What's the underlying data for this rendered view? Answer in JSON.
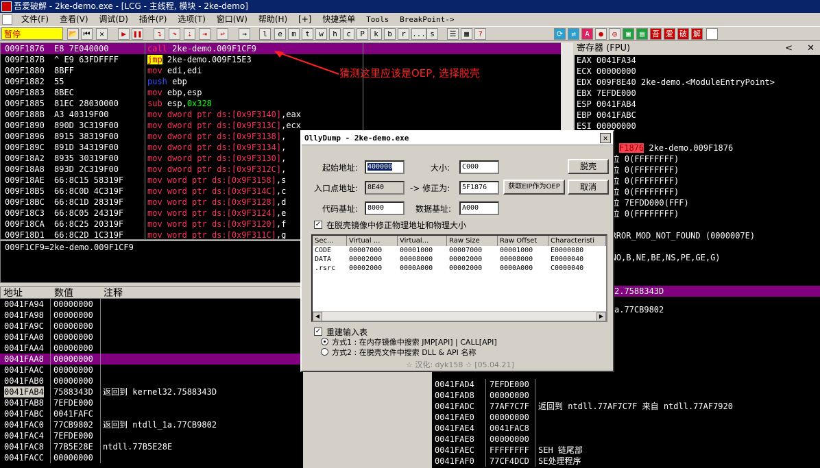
{
  "window": {
    "title": "吾爱破解 - 2ke-demo.exe - [LCG - 主线程, 模块 - 2ke-demo]"
  },
  "menu": [
    "文件(F)",
    "查看(V)",
    "调试(D)",
    "插件(P)",
    "选项(T)",
    "窗口(W)",
    "帮助(H)",
    "[+]",
    "快捷菜单",
    "Tools",
    "BreakPoint->"
  ],
  "toolbar": {
    "status": "暂停",
    "letters": [
      "l",
      "e",
      "m",
      "t",
      "w",
      "h",
      "c",
      "P",
      "k",
      "b",
      "r",
      "...",
      "s"
    ],
    "right_letters": [
      "A",
      "吾",
      "爱",
      "破",
      "解"
    ]
  },
  "disasm": {
    "rows": [
      {
        "addr": "009F1876",
        "hex": "E8 7E040000",
        "mn": "call",
        "op": "2ke-demo.009F1CF9",
        "sel": true
      },
      {
        "addr": "009F187B",
        "hex": "^ E9 63FDFFFF",
        "mn": "jmp",
        "op": "2ke-demo.009F15E3"
      },
      {
        "addr": "009F1880",
        "hex": "8BFF",
        "mn": "mov",
        "op": "edi,edi"
      },
      {
        "addr": "009F1882",
        "hex": "55",
        "mn": "push",
        "op": "ebp"
      },
      {
        "addr": "009F1883",
        "hex": "8BEC",
        "mn": "mov",
        "op": "ebp,esp"
      },
      {
        "addr": "009F1885",
        "hex": "81EC 28030000",
        "mn": "sub",
        "op": "esp,0x328"
      },
      {
        "addr": "009F188B",
        "hex": "A3 40319F00",
        "mn": "mov",
        "op": "dword ptr ds:[0x9F3140],eax"
      },
      {
        "addr": "009F1890",
        "hex": "890D 3C319F00",
        "mn": "mov",
        "op": "dword ptr ds:[0x9F313C],ecx"
      },
      {
        "addr": "009F1896",
        "hex": "8915 38319F00",
        "mn": "mov",
        "op": "dword ptr ds:[0x9F3138],"
      },
      {
        "addr": "009F189C",
        "hex": "891D 34319F00",
        "mn": "mov",
        "op": "dword ptr ds:[0x9F3134],"
      },
      {
        "addr": "009F18A2",
        "hex": "8935 30319F00",
        "mn": "mov",
        "op": "dword ptr ds:[0x9F3130],"
      },
      {
        "addr": "009F18A8",
        "hex": "893D 2C319F00",
        "mn": "mov",
        "op": "dword ptr ds:[0x9F312C],"
      },
      {
        "addr": "009F18AE",
        "hex": "66:8C15 58319F",
        "mn": "mov",
        "op": "word ptr ds:[0x9F3158],s"
      },
      {
        "addr": "009F18B5",
        "hex": "66:8C0D 4C319F",
        "mn": "mov",
        "op": "word ptr ds:[0x9F314C],c"
      },
      {
        "addr": "009F18BC",
        "hex": "66:8C1D 28319F",
        "mn": "mov",
        "op": "word ptr ds:[0x9F3128],d"
      },
      {
        "addr": "009F18C3",
        "hex": "66:8C05 24319F",
        "mn": "mov",
        "op": "word ptr ds:[0x9F3124],e"
      },
      {
        "addr": "009F18CA",
        "hex": "66:8C25 20319F",
        "mn": "mov",
        "op": "word ptr ds:[0x9F3120],f"
      },
      {
        "addr": "009F18D1",
        "hex": "66:8C2D 1C319F",
        "mn": "mov",
        "op": "word ptr ds:[0x9F311C],g"
      }
    ],
    "info": "009F1CF9=2ke-demo.009F1CF9"
  },
  "annotation": "猜测这里应该是OEP, 选择脱壳",
  "registers": {
    "header": "寄存器 (FPU)",
    "rows": [
      {
        "t": "EAX 0041FA34"
      },
      {
        "t": "ECX 00000000"
      },
      {
        "t": "EDX 009F8E40 2ke-demo.<ModuleEntryPoint>"
      },
      {
        "t": "EBX 7EFDE000"
      },
      {
        "t": "ESP 0041FAB4"
      },
      {
        "t": "EBP 0041FABC"
      },
      {
        "t": "ESI 00000000"
      },
      {
        "t": ""
      },
      {
        "eip": "F1876",
        "t": " 2ke-demo.009F1876"
      },
      {
        "t": "    002B 32位 0(FFFFFFFF)"
      },
      {
        "t": "    0023 32位 0(FFFFFFFF)"
      },
      {
        "t": "    002B 32位 0(FFFFFFFF)"
      },
      {
        "t": "    002B 32位 0(FFFFFFFF)"
      },
      {
        "t": "    0053 32位 7EFDD000(FFF)"
      },
      {
        "t": "    002B 32位 0(FFFFFFFF)"
      },
      {
        "t": ""
      },
      {
        "t": "    stErr ERROR_MOD_NOT_FOUND (0000007E)"
      },
      {
        "t": ""
      },
      {
        "t": "    00207 (NO,B,NE,BE,NS,PE,GE,G)"
      },
      {
        "t": ""
      },
      {
        "t": "    ty 0.0"
      }
    ]
  },
  "dump": {
    "headers": [
      "地址",
      "数值",
      "注释"
    ],
    "rows": [
      {
        "a": "0041FA94",
        "v": "00000000",
        "c": ""
      },
      {
        "a": "0041FA98",
        "v": "00000000",
        "c": ""
      },
      {
        "a": "0041FA9C",
        "v": "00000000",
        "c": ""
      },
      {
        "a": "0041FAA0",
        "v": "00000000",
        "c": ""
      },
      {
        "a": "0041FAA4",
        "v": "00000000",
        "c": ""
      },
      {
        "a": "0041FAA8",
        "v": "00000000",
        "c": "",
        "hl": true
      },
      {
        "a": "0041FAAC",
        "v": "00000000",
        "c": ""
      },
      {
        "a": "0041FAB0",
        "v": "00000000",
        "c": ""
      },
      {
        "a": "0041FAB4",
        "v": "7588343D",
        "c": "返回到 kernel32.7588343D",
        "inv": true
      },
      {
        "a": "0041FAB8",
        "v": "7EFDE000",
        "c": ""
      },
      {
        "a": "0041FABC",
        "v": "0041FAFC",
        "c": ""
      },
      {
        "a": "0041FAC0",
        "v": "77CB9802",
        "c": "返回到 ntdll_1a.77CB9802"
      },
      {
        "a": "0041FAC4",
        "v": "7EFDE000",
        "c": ""
      },
      {
        "a": "0041FAC8",
        "v": "77B5E28E",
        "c": "ntdll.77B5E28E"
      },
      {
        "a": "0041FACC",
        "v": "00000000",
        "c": ""
      }
    ]
  },
  "stack": {
    "top1": "2.7588343D",
    "top2": "a.77CB9802",
    "rows": [
      {
        "a": "0041FAD4",
        "v": "7EFDE000",
        "c": ""
      },
      {
        "a": "0041FAD8",
        "v": "00000000",
        "c": ""
      },
      {
        "a": "0041FADC",
        "v": "77AF7C7F",
        "c": "返回到 ntdll.77AF7C7F 来自 ntdll.77AF7920"
      },
      {
        "a": "0041FAE0",
        "v": "00000000",
        "c": ""
      },
      {
        "a": "0041FAE4",
        "v": "0041FAC8",
        "c": ""
      },
      {
        "a": "0041FAE8",
        "v": "00000000",
        "c": ""
      },
      {
        "a": "0041FAEC",
        "v": "FFFFFFFF",
        "c": "SEH 链尾部"
      },
      {
        "a": "0041FAF0",
        "v": "77CF4DCD",
        "c": "SE处理程序"
      }
    ]
  },
  "dialog": {
    "title": "OllyDump - 2ke-demo.exe",
    "base_label": "起始地址:",
    "base_value": "400000",
    "size_label": "大小:",
    "size_value": "C000",
    "dump_btn": "脱壳",
    "ep_label": "入口点地址:",
    "ep_value": "8E40",
    "modify_label": "-> 修正为:",
    "modify_value": "5F1876",
    "get_eip_btn": "获取EIP作为OEP",
    "cancel_btn": "取消",
    "code_label": "代码基址:",
    "code_value": "8000",
    "data_label": "数据基址:",
    "data_value": "A000",
    "fix_check": "在脱壳镜像中修正物理地址和物理大小",
    "sect_headers": [
      "Sec...",
      "Virtual ...",
      "Virtual...",
      "Raw Size",
      "Raw Offset",
      "Characteristi"
    ],
    "sections": [
      [
        "CODE",
        "00007000",
        "00001000",
        "00007000",
        "00001000",
        "E0000080"
      ],
      [
        "DATA",
        "00002000",
        "00008000",
        "00002000",
        "00008000",
        "E0000040"
      ],
      [
        ".rsrc",
        "00002000",
        "0000A000",
        "00002000",
        "0000A000",
        "C0000040"
      ]
    ],
    "rebuild_check": "重建输入表",
    "method1": "方式1 : 在内存镜像中搜索 JMP[API] | CALL[API]",
    "method2": "方式2 : 在脱壳文件中搜索 DLL & API 名称",
    "credit": "☆ 汉化: dyk158 ☆ [05.04.21]"
  }
}
